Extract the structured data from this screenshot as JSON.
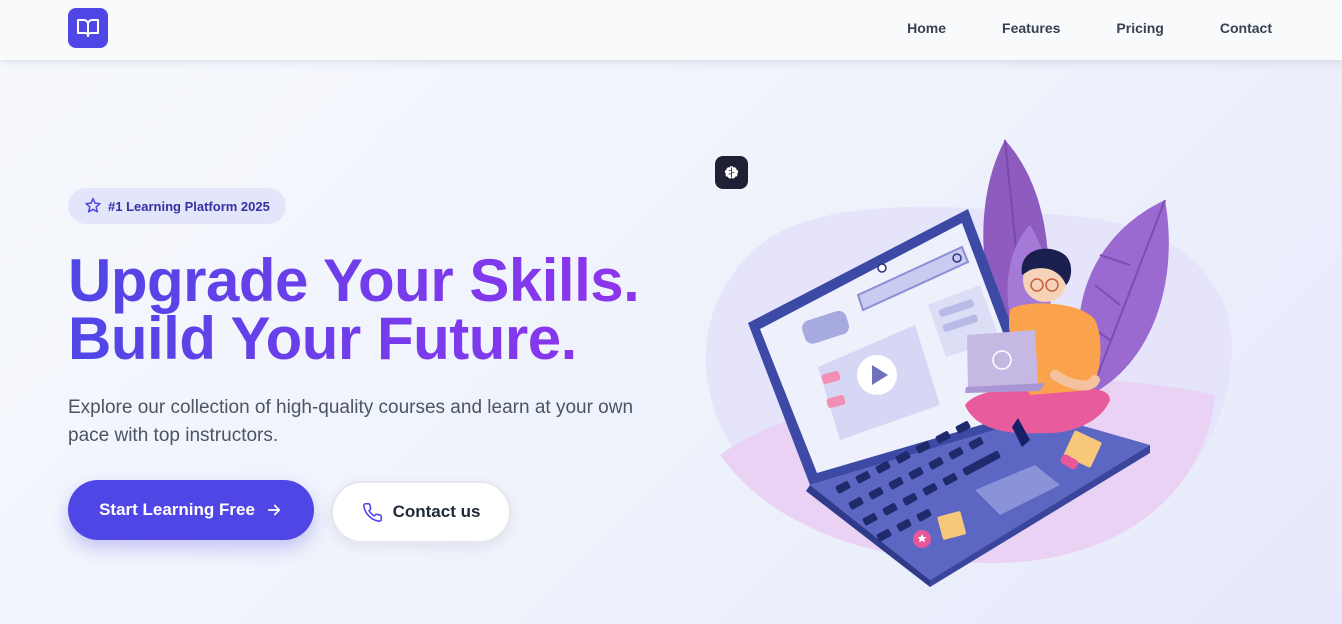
{
  "navbar": {
    "logo_icon": "book-open-icon",
    "links": [
      {
        "label": "Home"
      },
      {
        "label": "Features"
      },
      {
        "label": "Pricing"
      },
      {
        "label": "Contact"
      }
    ]
  },
  "hero": {
    "badge": {
      "icon": "star-badge-icon",
      "label": "#1 Learning Platform 2025"
    },
    "headline_line1": "Upgrade Your Skills.",
    "headline_line2": "Build Your Future.",
    "subtitle": "Explore our collection of high-quality courses and learn at your own pace with top instructors.",
    "primary_button": {
      "label": "Start Learning Free",
      "icon": "arrow-right-icon"
    },
    "secondary_button": {
      "label": "Contact us",
      "icon": "phone-icon"
    }
  },
  "illustration": {
    "ai_button_icon": "brain-icon",
    "subject": "person-with-laptop-illustration"
  },
  "colors": {
    "accent": "#4f46e5",
    "accent_purple": "#7c3aed",
    "nav_bg": "#f8fafc",
    "badge_bg": "#e3e6fb"
  }
}
